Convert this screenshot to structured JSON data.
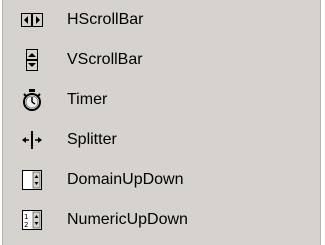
{
  "toolbox": {
    "items": [
      {
        "label": "HScrollBar",
        "icon": "hscrollbar-icon"
      },
      {
        "label": "VScrollBar",
        "icon": "vscrollbar-icon"
      },
      {
        "label": "Timer",
        "icon": "timer-icon"
      },
      {
        "label": "Splitter",
        "icon": "splitter-icon"
      },
      {
        "label": "DomainUpDown",
        "icon": "domainupdown-icon"
      },
      {
        "label": "NumericUpDown",
        "icon": "numericupdown-icon"
      }
    ]
  }
}
